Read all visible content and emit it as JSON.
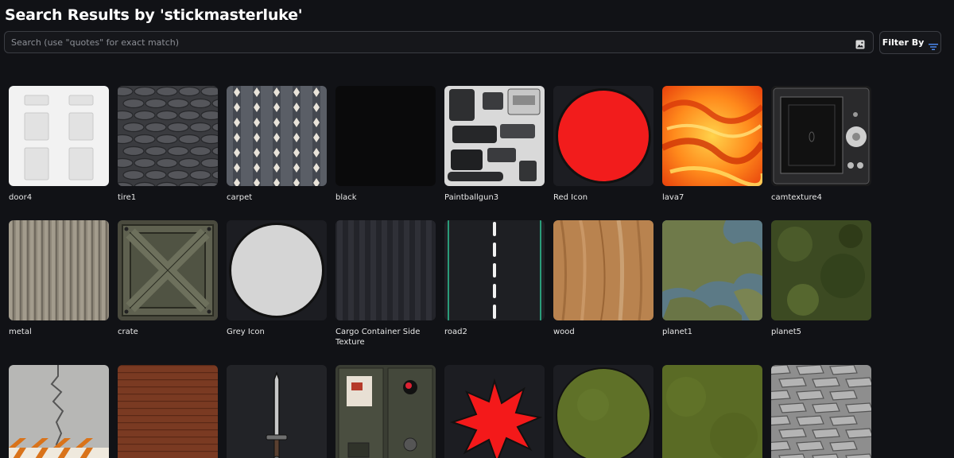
{
  "page": {
    "title": "Search Results by 'stickmasterluke'"
  },
  "search": {
    "placeholder": "Search (use \"quotes\" for exact match)",
    "value": "",
    "image_search_icon": "image-icon"
  },
  "filter": {
    "label": "Filter By",
    "icon": "filter-lines-icon",
    "accent_color": "#4d8df8"
  },
  "results": [
    {
      "name": "door4",
      "thumb": "door"
    },
    {
      "name": "tire1",
      "thumb": "tire-tread"
    },
    {
      "name": "carpet",
      "thumb": "carpet"
    },
    {
      "name": "black",
      "thumb": "black"
    },
    {
      "name": "Paintballgun3",
      "thumb": "gun-parts"
    },
    {
      "name": "Red Icon",
      "thumb": "red-circle"
    },
    {
      "name": "lava7",
      "thumb": "lava"
    },
    {
      "name": "camtexture4",
      "thumb": "camera"
    },
    {
      "name": "metal",
      "thumb": "corrugated-metal"
    },
    {
      "name": "crate",
      "thumb": "crate"
    },
    {
      "name": "Grey Icon",
      "thumb": "grey-circle"
    },
    {
      "name": "Cargo Container Side Texture",
      "thumb": "container-side"
    },
    {
      "name": "road2",
      "thumb": "road"
    },
    {
      "name": "wood",
      "thumb": "wood"
    },
    {
      "name": "planet1",
      "thumb": "planet-map"
    },
    {
      "name": "planet5",
      "thumb": "grass-map"
    },
    {
      "name": "",
      "thumb": "wall-crack"
    },
    {
      "name": "",
      "thumb": "brick"
    },
    {
      "name": "",
      "thumb": "sword"
    },
    {
      "name": "",
      "thumb": "metal-panel"
    },
    {
      "name": "",
      "thumb": "red-star"
    },
    {
      "name": "",
      "thumb": "green-circle"
    },
    {
      "name": "",
      "thumb": "grass"
    },
    {
      "name": "",
      "thumb": "tire-grey"
    }
  ]
}
